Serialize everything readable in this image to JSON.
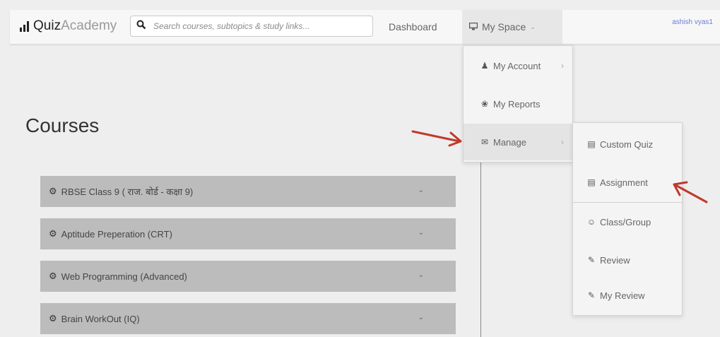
{
  "navbar": {
    "brand_part1": "Quiz",
    "brand_part2": "Academy",
    "search_placeholder": "Search courses, subtopics & study links...",
    "dashboard_label": "Dashboard",
    "myspace_label": "My Space",
    "user_text": "ashish vyas1"
  },
  "page": {
    "title": "Courses"
  },
  "courses": [
    {
      "label": "RBSE Class 9 ( राज. बोर्ड - कक्षा 9)"
    },
    {
      "label": "Aptitude Preperation (CRT)"
    },
    {
      "label": "Web Programming (Advanced)"
    },
    {
      "label": "Brain WorkOut (IQ)"
    }
  ],
  "myspace_menu": [
    {
      "label": "My Account",
      "icon": "user-icon",
      "has_submenu": true
    },
    {
      "label": "My Reports",
      "icon": "reports-icon",
      "has_submenu": false
    },
    {
      "label": "Manage",
      "icon": "envelope-icon",
      "has_submenu": true
    }
  ],
  "manage_menu": [
    {
      "label": "Custom Quiz",
      "icon": "list-icon"
    },
    {
      "label": "Assignment",
      "icon": "list-icon"
    },
    {
      "label": "Class/Group",
      "icon": "group-icon"
    },
    {
      "label": "Review",
      "icon": "edit-icon"
    },
    {
      "label": "My Review",
      "icon": "edit-icon"
    }
  ],
  "colors": {
    "annotation_arrow": "#c0392b",
    "user_link": "#6a7dd6"
  }
}
